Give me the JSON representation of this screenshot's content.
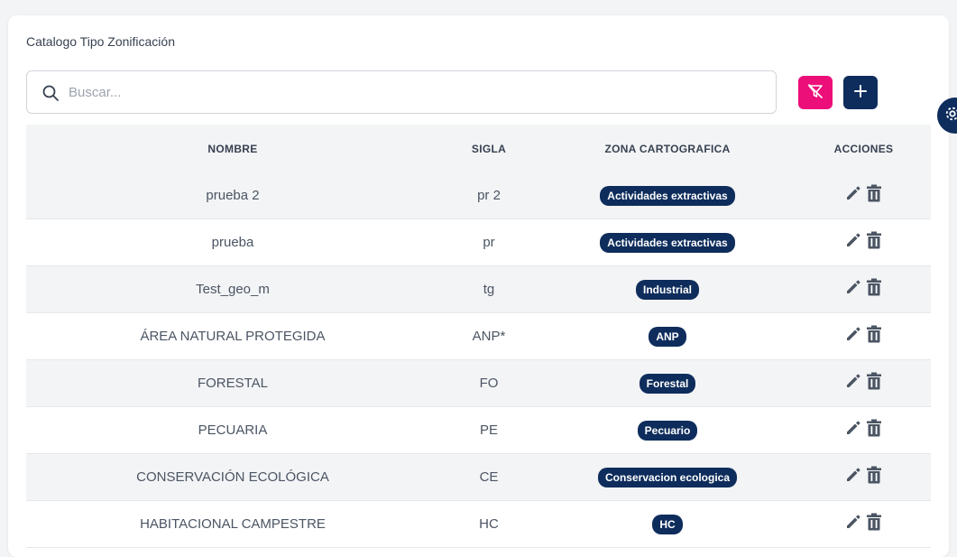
{
  "page": {
    "title": "Catalogo Tipo Zonificación"
  },
  "search": {
    "placeholder": "Buscar...",
    "value": ""
  },
  "colors": {
    "filter_button": "#ec0f7a",
    "add_button": "#0e2d5c",
    "badge": "#0e2d5c",
    "icon": "#4b5563"
  },
  "table": {
    "headers": [
      "NOMBRE",
      "SIGLA",
      "ZONA CARTOGRAFICA",
      "ACCIONES"
    ],
    "rows": [
      {
        "nombre": "prueba 2",
        "sigla": "pr 2",
        "zona": "Actividades extractivas"
      },
      {
        "nombre": "prueba",
        "sigla": "pr",
        "zona": "Actividades extractivas"
      },
      {
        "nombre": "Test_geo_m",
        "sigla": "tg",
        "zona": "Industrial"
      },
      {
        "nombre": "ÁREA NATURAL PROTEGIDA",
        "sigla": "ANP*",
        "zona": "ANP"
      },
      {
        "nombre": "FORESTAL",
        "sigla": "FO",
        "zona": "Forestal"
      },
      {
        "nombre": "PECUARIA",
        "sigla": "PE",
        "zona": "Pecuario"
      },
      {
        "nombre": "CONSERVACIÓN ECOLÓGICA",
        "sigla": "CE",
        "zona": "Conservacion ecologica"
      },
      {
        "nombre": "HABITACIONAL CAMPESTRE",
        "sigla": "HC",
        "zona": "HC"
      }
    ]
  },
  "icons": {
    "search": "search-icon",
    "filter_off": "filter-off-icon",
    "add": "plus-icon",
    "edit": "pencil-icon",
    "delete": "trash-icon",
    "settings": "gear-icon"
  }
}
